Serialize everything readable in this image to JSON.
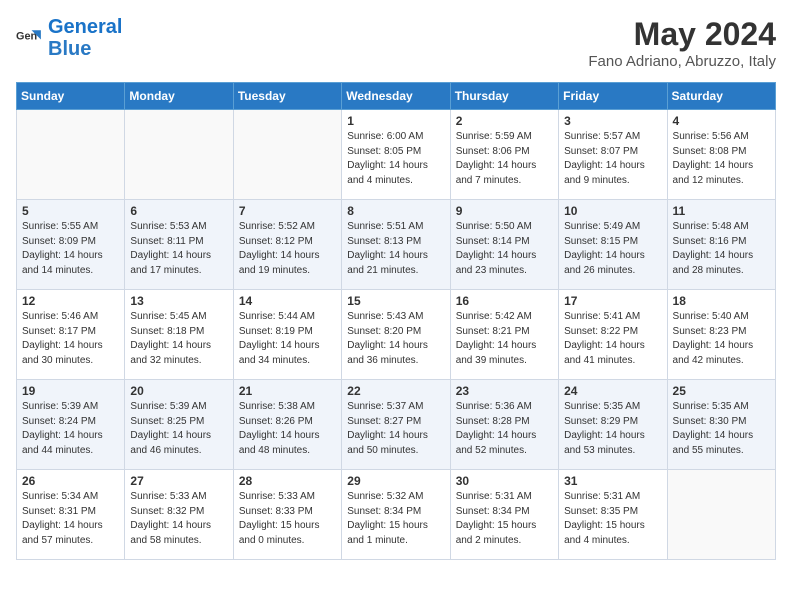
{
  "header": {
    "logo_general": "General",
    "logo_blue": "Blue",
    "month": "May 2024",
    "location": "Fano Adriano, Abruzzo, Italy"
  },
  "days_of_week": [
    "Sunday",
    "Monday",
    "Tuesday",
    "Wednesday",
    "Thursday",
    "Friday",
    "Saturday"
  ],
  "weeks": [
    [
      {
        "day": "",
        "sunrise": "",
        "sunset": "",
        "daylight": ""
      },
      {
        "day": "",
        "sunrise": "",
        "sunset": "",
        "daylight": ""
      },
      {
        "day": "",
        "sunrise": "",
        "sunset": "",
        "daylight": ""
      },
      {
        "day": "1",
        "sunrise": "Sunrise: 6:00 AM",
        "sunset": "Sunset: 8:05 PM",
        "daylight": "Daylight: 14 hours and 4 minutes."
      },
      {
        "day": "2",
        "sunrise": "Sunrise: 5:59 AM",
        "sunset": "Sunset: 8:06 PM",
        "daylight": "Daylight: 14 hours and 7 minutes."
      },
      {
        "day": "3",
        "sunrise": "Sunrise: 5:57 AM",
        "sunset": "Sunset: 8:07 PM",
        "daylight": "Daylight: 14 hours and 9 minutes."
      },
      {
        "day": "4",
        "sunrise": "Sunrise: 5:56 AM",
        "sunset": "Sunset: 8:08 PM",
        "daylight": "Daylight: 14 hours and 12 minutes."
      }
    ],
    [
      {
        "day": "5",
        "sunrise": "Sunrise: 5:55 AM",
        "sunset": "Sunset: 8:09 PM",
        "daylight": "Daylight: 14 hours and 14 minutes."
      },
      {
        "day": "6",
        "sunrise": "Sunrise: 5:53 AM",
        "sunset": "Sunset: 8:11 PM",
        "daylight": "Daylight: 14 hours and 17 minutes."
      },
      {
        "day": "7",
        "sunrise": "Sunrise: 5:52 AM",
        "sunset": "Sunset: 8:12 PM",
        "daylight": "Daylight: 14 hours and 19 minutes."
      },
      {
        "day": "8",
        "sunrise": "Sunrise: 5:51 AM",
        "sunset": "Sunset: 8:13 PM",
        "daylight": "Daylight: 14 hours and 21 minutes."
      },
      {
        "day": "9",
        "sunrise": "Sunrise: 5:50 AM",
        "sunset": "Sunset: 8:14 PM",
        "daylight": "Daylight: 14 hours and 23 minutes."
      },
      {
        "day": "10",
        "sunrise": "Sunrise: 5:49 AM",
        "sunset": "Sunset: 8:15 PM",
        "daylight": "Daylight: 14 hours and 26 minutes."
      },
      {
        "day": "11",
        "sunrise": "Sunrise: 5:48 AM",
        "sunset": "Sunset: 8:16 PM",
        "daylight": "Daylight: 14 hours and 28 minutes."
      }
    ],
    [
      {
        "day": "12",
        "sunrise": "Sunrise: 5:46 AM",
        "sunset": "Sunset: 8:17 PM",
        "daylight": "Daylight: 14 hours and 30 minutes."
      },
      {
        "day": "13",
        "sunrise": "Sunrise: 5:45 AM",
        "sunset": "Sunset: 8:18 PM",
        "daylight": "Daylight: 14 hours and 32 minutes."
      },
      {
        "day": "14",
        "sunrise": "Sunrise: 5:44 AM",
        "sunset": "Sunset: 8:19 PM",
        "daylight": "Daylight: 14 hours and 34 minutes."
      },
      {
        "day": "15",
        "sunrise": "Sunrise: 5:43 AM",
        "sunset": "Sunset: 8:20 PM",
        "daylight": "Daylight: 14 hours and 36 minutes."
      },
      {
        "day": "16",
        "sunrise": "Sunrise: 5:42 AM",
        "sunset": "Sunset: 8:21 PM",
        "daylight": "Daylight: 14 hours and 39 minutes."
      },
      {
        "day": "17",
        "sunrise": "Sunrise: 5:41 AM",
        "sunset": "Sunset: 8:22 PM",
        "daylight": "Daylight: 14 hours and 41 minutes."
      },
      {
        "day": "18",
        "sunrise": "Sunrise: 5:40 AM",
        "sunset": "Sunset: 8:23 PM",
        "daylight": "Daylight: 14 hours and 42 minutes."
      }
    ],
    [
      {
        "day": "19",
        "sunrise": "Sunrise: 5:39 AM",
        "sunset": "Sunset: 8:24 PM",
        "daylight": "Daylight: 14 hours and 44 minutes."
      },
      {
        "day": "20",
        "sunrise": "Sunrise: 5:39 AM",
        "sunset": "Sunset: 8:25 PM",
        "daylight": "Daylight: 14 hours and 46 minutes."
      },
      {
        "day": "21",
        "sunrise": "Sunrise: 5:38 AM",
        "sunset": "Sunset: 8:26 PM",
        "daylight": "Daylight: 14 hours and 48 minutes."
      },
      {
        "day": "22",
        "sunrise": "Sunrise: 5:37 AM",
        "sunset": "Sunset: 8:27 PM",
        "daylight": "Daylight: 14 hours and 50 minutes."
      },
      {
        "day": "23",
        "sunrise": "Sunrise: 5:36 AM",
        "sunset": "Sunset: 8:28 PM",
        "daylight": "Daylight: 14 hours and 52 minutes."
      },
      {
        "day": "24",
        "sunrise": "Sunrise: 5:35 AM",
        "sunset": "Sunset: 8:29 PM",
        "daylight": "Daylight: 14 hours and 53 minutes."
      },
      {
        "day": "25",
        "sunrise": "Sunrise: 5:35 AM",
        "sunset": "Sunset: 8:30 PM",
        "daylight": "Daylight: 14 hours and 55 minutes."
      }
    ],
    [
      {
        "day": "26",
        "sunrise": "Sunrise: 5:34 AM",
        "sunset": "Sunset: 8:31 PM",
        "daylight": "Daylight: 14 hours and 57 minutes."
      },
      {
        "day": "27",
        "sunrise": "Sunrise: 5:33 AM",
        "sunset": "Sunset: 8:32 PM",
        "daylight": "Daylight: 14 hours and 58 minutes."
      },
      {
        "day": "28",
        "sunrise": "Sunrise: 5:33 AM",
        "sunset": "Sunset: 8:33 PM",
        "daylight": "Daylight: 15 hours and 0 minutes."
      },
      {
        "day": "29",
        "sunrise": "Sunrise: 5:32 AM",
        "sunset": "Sunset: 8:34 PM",
        "daylight": "Daylight: 15 hours and 1 minute."
      },
      {
        "day": "30",
        "sunrise": "Sunrise: 5:31 AM",
        "sunset": "Sunset: 8:34 PM",
        "daylight": "Daylight: 15 hours and 2 minutes."
      },
      {
        "day": "31",
        "sunrise": "Sunrise: 5:31 AM",
        "sunset": "Sunset: 8:35 PM",
        "daylight": "Daylight: 15 hours and 4 minutes."
      },
      {
        "day": "",
        "sunrise": "",
        "sunset": "",
        "daylight": ""
      }
    ]
  ]
}
